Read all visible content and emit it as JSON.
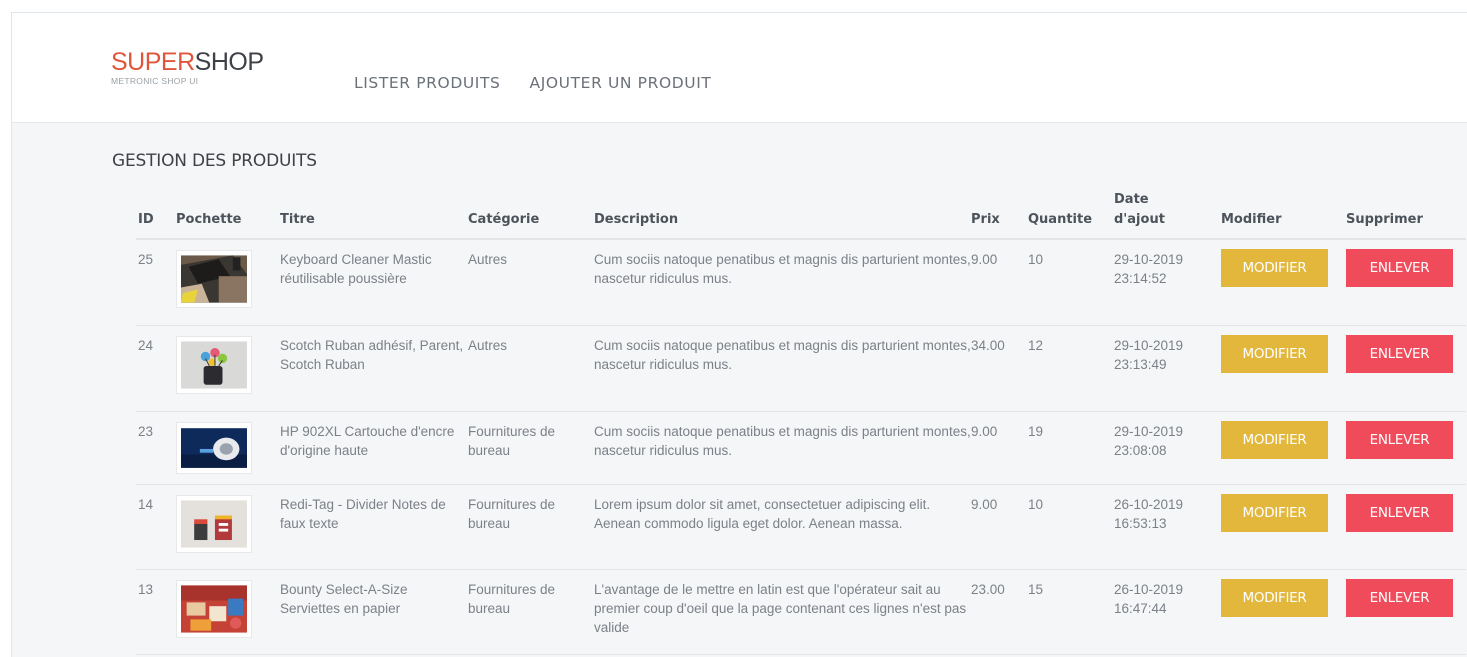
{
  "brand": {
    "title_part1": "SUPER",
    "title_part2": "SHOP",
    "subtitle": "METRONIC SHOP UI"
  },
  "nav": {
    "items": [
      {
        "label": "LISTER PRODUITS"
      },
      {
        "label": "AJOUTER UN PRODUIT"
      }
    ]
  },
  "page": {
    "title": "GESTION DES PRODUITS"
  },
  "table": {
    "headers": {
      "id": "ID",
      "pochette": "Pochette",
      "titre": "Titre",
      "categorie": "Catégorie",
      "description": "Description",
      "prix": "Prix",
      "quantite": "Quantite",
      "date_line1": "Date",
      "date_line2": "d'ajout",
      "modifier": "Modifier",
      "supprimer": "Supprimer"
    },
    "rows": [
      {
        "id": "25",
        "thumb_icon": "keyboard-cleaner-photo",
        "titre": "Keyboard Cleaner Mastic réutilisable poussière",
        "categorie": "Autres",
        "description": "Cum sociis natoque penatibus et magnis dis parturient montes, nascetur ridiculus mus.",
        "prix": "9.00",
        "quantite": "10",
        "date": "29-10-2019",
        "time": "23:14:52",
        "modifier_label": "MODIFIER",
        "supprimer_label": "ENLEVER"
      },
      {
        "id": "24",
        "thumb_icon": "scotch-tape-photo",
        "titre": "Scotch Ruban adhésif, Parent, Scotch Ruban",
        "categorie": "Autres",
        "description": "Cum sociis natoque penatibus et magnis dis parturient montes, nascetur ridiculus mus.",
        "prix": "34.00",
        "quantite": "12",
        "date": "29-10-2019",
        "time": "23:13:49",
        "modifier_label": "MODIFIER",
        "supprimer_label": "ENLEVER"
      },
      {
        "id": "23",
        "thumb_icon": "ink-cartridge-photo",
        "titre": "HP 902XL Cartouche d'encre d'origine haute",
        "categorie": "Fournitures de bureau",
        "description": "Cum sociis natoque penatibus et magnis dis parturient montes, nascetur ridiculus mus.",
        "prix": "9.00",
        "quantite": "19",
        "date": "29-10-2019",
        "time": "23:08:08",
        "modifier_label": "MODIFIER",
        "supprimer_label": "ENLEVER"
      },
      {
        "id": "14",
        "thumb_icon": "divider-tabs-photo",
        "titre": "Redi-Tag - Divider Notes de faux texte",
        "categorie": "Fournitures de bureau",
        "description": "Lorem ipsum dolor sit amet, consectetuer adipiscing elit. Aenean commodo ligula eget dolor. Aenean massa.",
        "prix": "9.00",
        "quantite": "10",
        "date": "26-10-2019",
        "time": "16:53:13",
        "modifier_label": "MODIFIER",
        "supprimer_label": "ENLEVER"
      },
      {
        "id": "13",
        "thumb_icon": "napkins-photo",
        "titre": "Bounty Select-A-Size Serviettes en papier",
        "categorie": "Fournitures de bureau",
        "description": "L'avantage de le mettre en latin est que l'opérateur sait au premier coup d'oeil que la page contenant ces lignes n'est pas valide",
        "prix": "23.00",
        "quantite": "15",
        "date": "26-10-2019",
        "time": "16:47:44",
        "modifier_label": "MODIFIER",
        "supprimer_label": "ENLEVER"
      }
    ]
  },
  "colors": {
    "brand_red": "#e0563c",
    "modify_button": "#e2b73c",
    "delete_button": "#ef4b5b"
  }
}
